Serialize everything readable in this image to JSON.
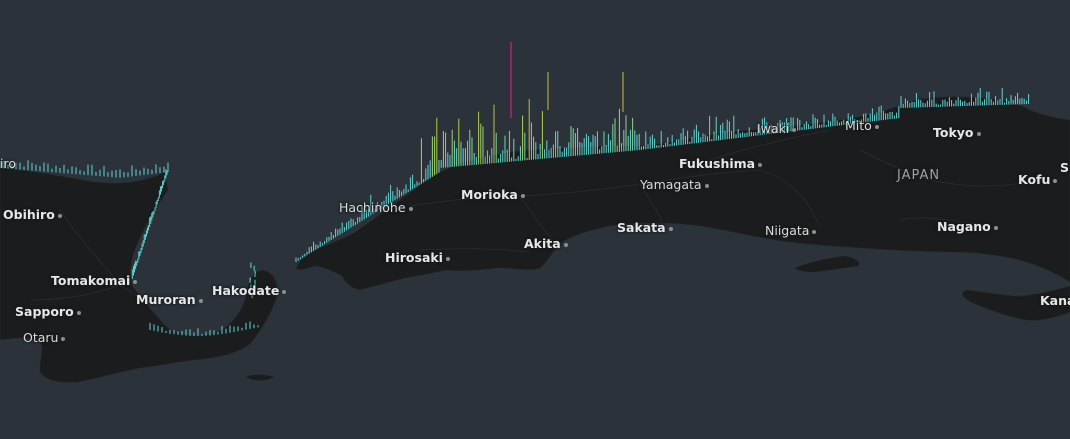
{
  "map": {
    "country_label": "JAPAN",
    "cities": [
      {
        "id": "obihiro",
        "name": "Obihiro"
      },
      {
        "id": "tomakomai",
        "name": "Tomakomai"
      },
      {
        "id": "muroran",
        "name": "Muroran"
      },
      {
        "id": "sapporo",
        "name": "Sapporo"
      },
      {
        "id": "otaru",
        "name": "Otaru"
      },
      {
        "id": "hakodate",
        "name": "Hakodate"
      },
      {
        "id": "hachinohe",
        "name": "Hachinohe"
      },
      {
        "id": "morioka",
        "name": "Morioka"
      },
      {
        "id": "hirosaki",
        "name": "Hirosaki"
      },
      {
        "id": "akita",
        "name": "Akita"
      },
      {
        "id": "yamagata",
        "name": "Yamagata"
      },
      {
        "id": "sakata",
        "name": "Sakata"
      },
      {
        "id": "fukushima",
        "name": "Fukushima"
      },
      {
        "id": "iwaki",
        "name": "Iwaki"
      },
      {
        "id": "mito",
        "name": "Mito"
      },
      {
        "id": "niigata",
        "name": "Niigata"
      },
      {
        "id": "tokyo",
        "name": "Tokyo"
      },
      {
        "id": "kofu",
        "name": "Kofu"
      },
      {
        "id": "nagano",
        "name": "Nagano"
      },
      {
        "id": "kana",
        "name": "Kana"
      },
      {
        "id": "s-edge",
        "name": "S"
      },
      {
        "id": "iro-edge",
        "name": "iro"
      }
    ],
    "colors": {
      "water": "#2b323a",
      "land": "#1b1c1d",
      "bar_low": "#5fd6d3",
      "bar_mid": "#a9d456",
      "bar_high": "#e0a428",
      "bar_peak": "#c0207a"
    }
  }
}
